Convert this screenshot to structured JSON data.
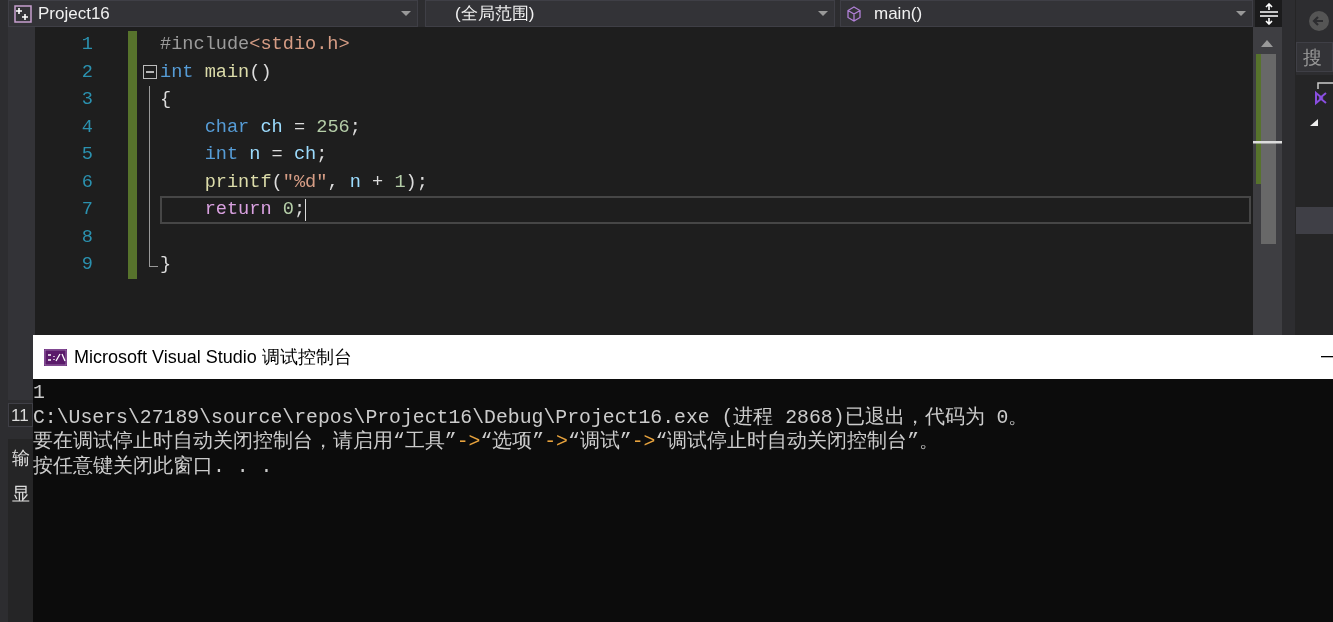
{
  "toolbar": {
    "dropdowns": [
      {
        "kind": "project",
        "label": "Project16"
      },
      {
        "kind": "scope",
        "label": "(全局范围)"
      },
      {
        "kind": "member",
        "label": "main()"
      }
    ]
  },
  "editor": {
    "lines": [
      {
        "number": "1",
        "modified": true,
        "current": false,
        "tokens": [
          {
            "text": "#include",
            "kind": "preprocessor"
          },
          {
            "text": "<stdio.h>",
            "kind": "string"
          }
        ]
      },
      {
        "number": "2",
        "modified": true,
        "current": false,
        "expanded": true,
        "tokens": [
          {
            "text": "int",
            "kind": "keyword"
          },
          {
            "text": " main",
            "kind": "function"
          },
          {
            "text": "()",
            "kind": "plain"
          }
        ],
        "children": [
          {
            "number": "3",
            "modified": true,
            "current": false,
            "tokens": [
              {
                "text": "{",
                "kind": "plain"
              }
            ]
          },
          {
            "number": "4",
            "modified": true,
            "current": false,
            "tokens": [
              {
                "text": "    char",
                "kind": "keyword"
              },
              {
                "text": " ch",
                "kind": "variable"
              },
              {
                "text": " = ",
                "kind": "plain"
              },
              {
                "text": "256",
                "kind": "number"
              },
              {
                "text": ";",
                "kind": "plain"
              }
            ]
          },
          {
            "number": "5",
            "modified": true,
            "current": false,
            "tokens": [
              {
                "text": "    int",
                "kind": "keyword"
              },
              {
                "text": " n",
                "kind": "variable"
              },
              {
                "text": " = ",
                "kind": "plain"
              },
              {
                "text": "ch",
                "kind": "variable"
              },
              {
                "text": ";",
                "kind": "plain"
              }
            ]
          },
          {
            "number": "6",
            "modified": true,
            "current": false,
            "tokens": [
              {
                "text": "    printf",
                "kind": "function"
              },
              {
                "text": "(",
                "kind": "plain"
              },
              {
                "text": "\"%d\"",
                "kind": "string"
              },
              {
                "text": ", ",
                "kind": "plain"
              },
              {
                "text": "n",
                "kind": "variable"
              },
              {
                "text": " + ",
                "kind": "plain"
              },
              {
                "text": "1",
                "kind": "number"
              },
              {
                "text": ");",
                "kind": "plain"
              }
            ]
          },
          {
            "number": "7",
            "modified": true,
            "current": true,
            "tokens": [
              {
                "text": "    return",
                "kind": "control"
              },
              {
                "text": " 0",
                "kind": "number"
              },
              {
                "text": ";",
                "kind": "plain"
              }
            ]
          },
          {
            "number": "8",
            "modified": true,
            "current": false
          },
          {
            "number": "9",
            "modified": true,
            "current": false,
            "tokens": [
              {
                "text": "}",
                "kind": "plain"
              }
            ]
          }
        ]
      }
    ]
  },
  "side_panel": {
    "search_placeholder": "搜"
  },
  "left_strip": {
    "line_indicator": "11",
    "labels": [
      "输",
      "显"
    ]
  },
  "console": {
    "title": "Microsoft Visual Studio 调试控制台",
    "lines": [
      [
        {
          "text": "1",
          "kind": "plain"
        }
      ],
      [
        {
          "text": "C:\\Users\\27189\\source\\repos\\Project16\\Debug\\Project16.exe (进程 2868)已退出，代码为 0。",
          "kind": "plain"
        }
      ],
      [
        {
          "text": "要在调试停止时自动关闭控制台，请启用“工具”",
          "kind": "plain"
        },
        {
          "text": "->",
          "kind": "arrow"
        },
        {
          "text": "“选项”",
          "kind": "plain"
        },
        {
          "text": "->",
          "kind": "arrow"
        },
        {
          "text": "“调试”",
          "kind": "plain"
        },
        {
          "text": "->",
          "kind": "arrow"
        },
        {
          "text": "“调试停止时自动关闭控制台”。",
          "kind": "plain"
        }
      ],
      [
        {
          "text": "按任意键关闭此窗口. . .",
          "kind": "plain"
        }
      ]
    ]
  }
}
